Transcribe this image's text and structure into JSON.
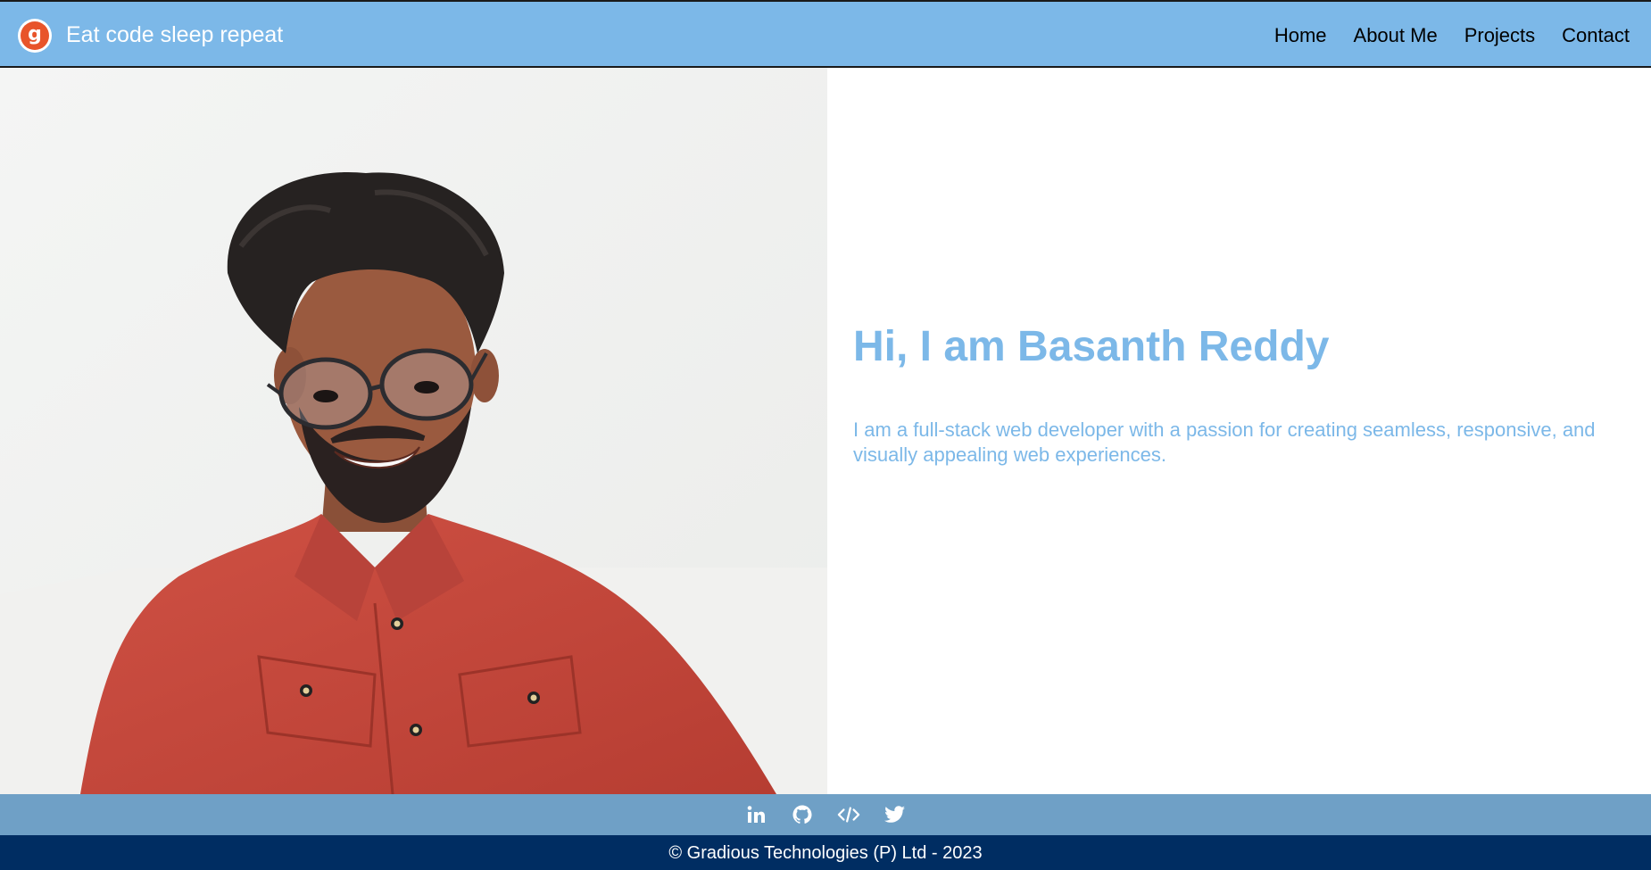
{
  "header": {
    "logo_letter": "g",
    "brand": "Eat code sleep repeat",
    "nav": [
      "Home",
      "About Me",
      "Projects",
      "Contact"
    ]
  },
  "hero": {
    "title": "Hi, I am Basanth Reddy",
    "description": "I am a full-stack web developer with a passion for creating seamless, responsive, and visually appealing web experiences."
  },
  "social": {
    "icons": [
      "linkedin-icon",
      "github-icon",
      "code-icon",
      "twitter-icon"
    ]
  },
  "footer": {
    "copyright": "© Gradious Technologies (P) Ltd - 2023"
  },
  "colors": {
    "header_bg": "#7cb8e8",
    "accent": "#7cb8e8",
    "social_bg": "#6fa0c6",
    "footer_bg": "#002d62",
    "logo_orange": "#e8542a",
    "shirt_red": "#c9493c"
  }
}
